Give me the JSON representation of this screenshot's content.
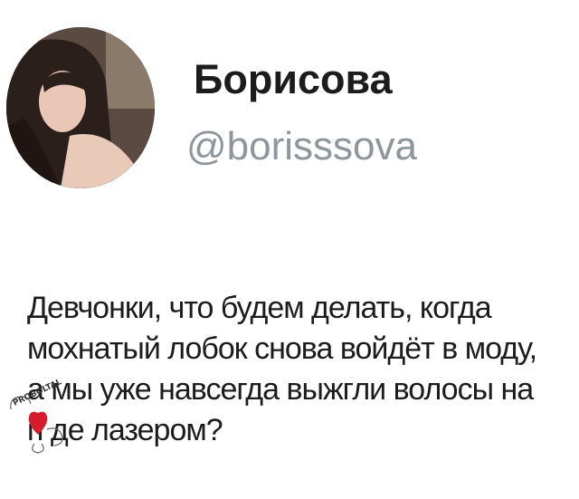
{
  "profile": {
    "display_name": "Борисова",
    "handle": "@borisssova"
  },
  "tweet": {
    "lines": [
      "Девчонки, что будем делать, когда",
      "мохнатый лобок снова войдёт в моду,",
      "а мы уже навсегда выжгли волосы на",
      "п   де лазером?"
    ]
  },
  "watermark": {
    "text": "PROBOLTAL",
    "icon": "heart-stamp-icon",
    "color": "#d81b2a"
  }
}
